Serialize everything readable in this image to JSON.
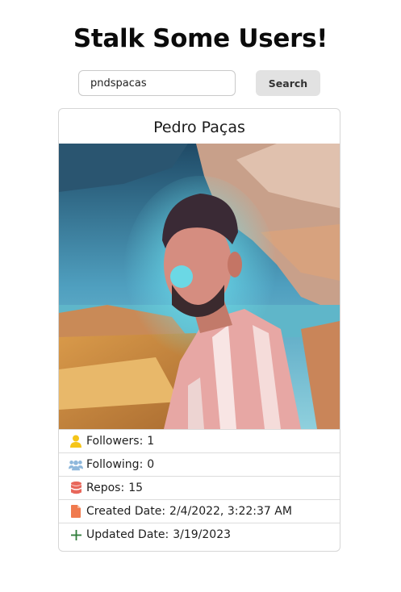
{
  "page": {
    "title": "Stalk Some Users!"
  },
  "search": {
    "value": "pndspacas",
    "button_label": "Search"
  },
  "profile": {
    "name": "Pedro Paças",
    "stats": [
      {
        "label": "Followers:",
        "value": "1",
        "icon": "user-icon",
        "icon_color": "#f5c518"
      },
      {
        "label": "Following:",
        "value": "0",
        "icon": "users-icon",
        "icon_color": "#8fb8dc"
      },
      {
        "label": "Repos:",
        "value": "15",
        "icon": "database-icon",
        "icon_color": "#e8675b"
      },
      {
        "label": "Created Date:",
        "value": "2/4/2022, 3:22:37 AM",
        "icon": "file-icon",
        "icon_color": "#f07a4e"
      },
      {
        "label": "Updated Date:",
        "value": "3/19/2023",
        "icon": "plus-icon",
        "icon_color": "#2f7d3a"
      }
    ]
  }
}
